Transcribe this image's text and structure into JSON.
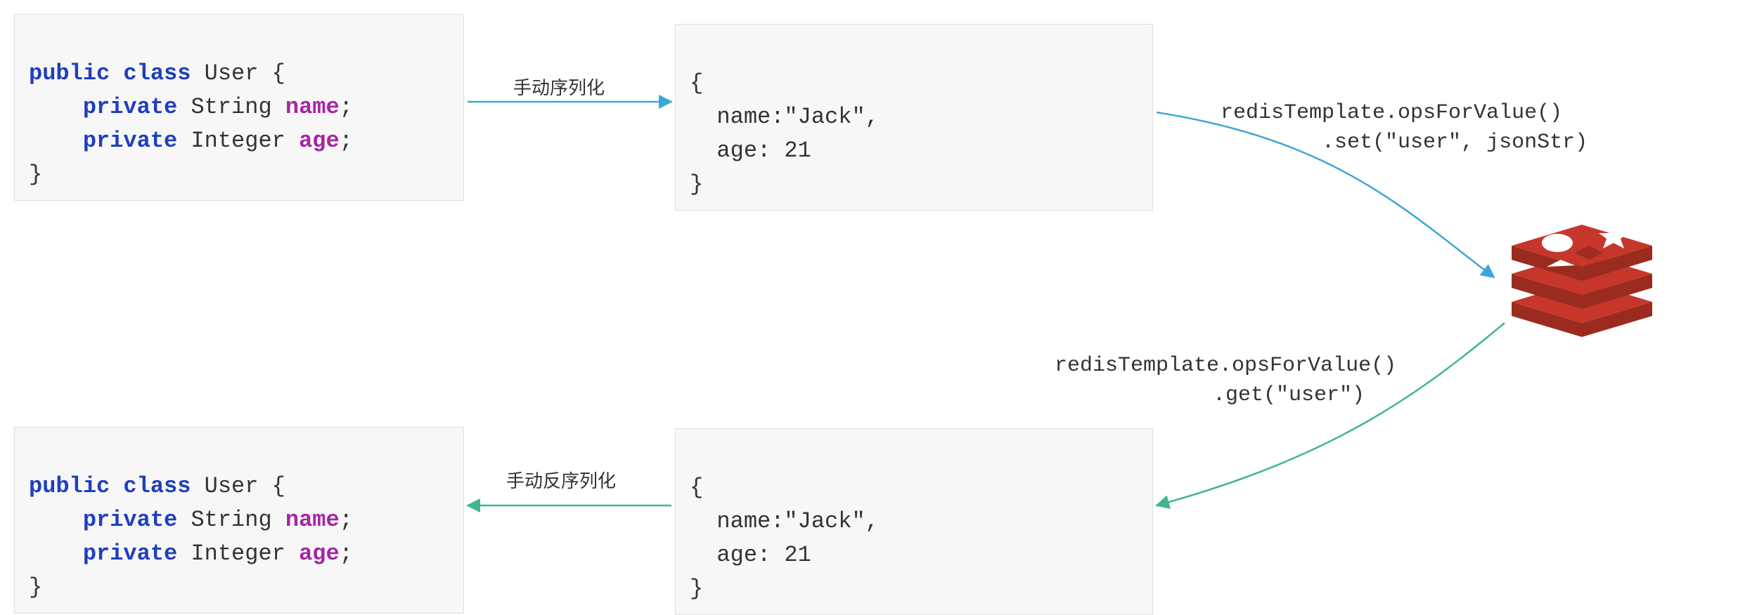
{
  "classTop": {
    "line1_kw1": "public",
    "line1_kw2": "class",
    "line1_name": "User {",
    "line2_kw": "private",
    "line2_type": "String",
    "line2_field": "name",
    "line3_kw": "private",
    "line3_type": "Integer",
    "line3_field": "age",
    "close": "}"
  },
  "classBottom": {
    "line1_kw1": "public",
    "line1_kw2": "class",
    "line1_name": "User {",
    "line2_kw": "private",
    "line2_type": "String",
    "line2_field": "name",
    "line3_kw": "private",
    "line3_type": "Integer",
    "line3_field": "age",
    "close": "}"
  },
  "jsonTop": {
    "open": "{",
    "line1": "  name:\"Jack\",",
    "line2": "  age: 21",
    "close": "}"
  },
  "jsonBottom": {
    "open": "{",
    "line1": "  name:\"Jack\",",
    "line2": "  age: 21",
    "close": "}"
  },
  "labels": {
    "serialize": "手动序列化",
    "deserialize": "手动反序列化",
    "setCall": "redisTemplate.opsForValue()\n          .set(\"user\", jsonStr)",
    "getCall": "redisTemplate.opsForValue()\n          .get(\"user\")"
  }
}
